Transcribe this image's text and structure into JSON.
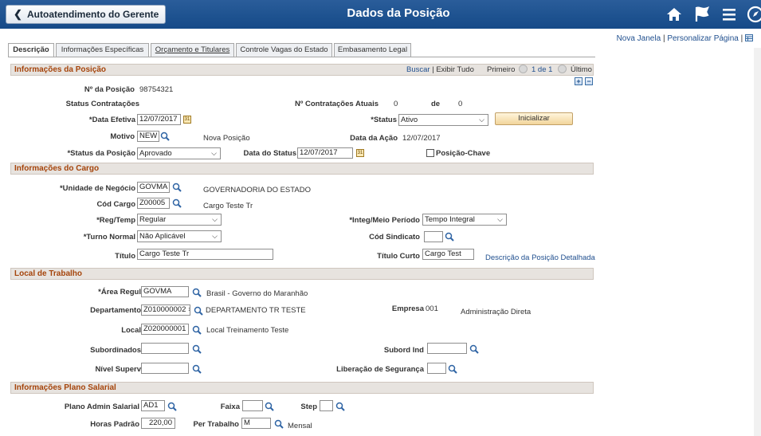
{
  "header": {
    "back_label": "Autoatendimento do Gerente",
    "title": "Dados da Posição"
  },
  "toplinks": {
    "new_window": "Nova Janela",
    "personalize": "Personalizar Página",
    "sep": "|"
  },
  "tabs": [
    "Descrição",
    "Informações Específicas",
    "Orçamento e Titulares",
    "Controle Vagas do Estado",
    "Embasamento Legal"
  ],
  "posinfo": {
    "title": "Informações da Posição",
    "find": "Buscar",
    "sep": "|",
    "view_all": "Exibir Tudo",
    "first": "Primeiro",
    "count": "1 de 1",
    "last": "Último",
    "plus": "+",
    "minus": "−",
    "num_lbl": "Nº da Posição",
    "num_val": "98754321",
    "status_contr_lbl": "Status Contratações",
    "num_contr_lbl": "Nº Contratações Atuais",
    "num_contr_val": "0",
    "de_lbl": "de",
    "de_val": "0",
    "eff_lbl": "*Data Efetiva",
    "eff_val": "12/07/2017",
    "status_lbl": "*Status",
    "status_val": "Ativo",
    "init_btn": "Inicializar",
    "motivo_lbl": "Motivo",
    "motivo_val": "NEW",
    "motivo_desc": "Nova Posição",
    "action_date_lbl": "Data da Ação",
    "action_date_val": "12/07/2017",
    "pos_status_lbl": "*Status da Posição",
    "pos_status_val": "Aprovado",
    "status_date_lbl": "Data do Status",
    "status_date_val": "12/07/2017",
    "key_pos_lbl": "Posição-Chave"
  },
  "job": {
    "title": "Informações do Cargo",
    "bu_lbl": "*Unidade de Negócio",
    "bu_val": "GOVMA",
    "bu_desc": "GOVERNADORIA DO ESTADO",
    "job_code_lbl": "Cód Cargo",
    "job_code_val": "Z00005",
    "job_code_desc": "Cargo Teste Tr",
    "regtemp_lbl": "*Reg/Temp",
    "regtemp_val": "Regular",
    "fullpart_lbl": "*Integ/Meio Período",
    "fullpart_val": "Tempo Integral",
    "shift_lbl": "*Turno Normal",
    "shift_val": "Não Aplicável",
    "union_lbl": "Cód Sindicato",
    "union_val": "",
    "title_lbl": "Título",
    "title_val": "Cargo Teste Tr",
    "short_title_lbl": "Título Curto",
    "short_title_val": "Cargo Test",
    "detail_link": "Descrição da Posição Detalhada"
  },
  "work": {
    "title": "Local de Trabalho",
    "reg_area_lbl": "*Área Regul",
    "reg_area_val": "GOVMA",
    "reg_area_desc": "Brasil - Governo do Maranhão",
    "dept_lbl": "Departamento",
    "dept_val": "Z010000002",
    "dept_clear": "×",
    "dept_desc": "DEPARTAMENTO TR TESTE",
    "company_lbl": "Empresa",
    "company_val": "001",
    "company_desc": "Administração Direta",
    "location_lbl": "Local",
    "location_val": "Z020000001",
    "location_desc": "Local Treinamento Teste",
    "reports_to_lbl": "Subordinados",
    "reports_to_val": "",
    "dotted_lbl": "Subord Ind",
    "dotted_val": "",
    "super_lvl_lbl": "Nível Superv",
    "super_lvl_val": "",
    "security_lbl": "Liberação de Segurança",
    "security_val": ""
  },
  "salary": {
    "title": "Informações Plano Salarial",
    "plan_lbl": "Plano Admin Salarial",
    "plan_val": "AD1",
    "grade_lbl": "Faixa",
    "grade_val": "",
    "step_lbl": "Step",
    "step_val": "",
    "hours_lbl": "Horas Padrão",
    "hours_val": "220,00",
    "period_lbl": "Per Trabalho",
    "period_val": "M",
    "period_desc": "Mensal"
  }
}
